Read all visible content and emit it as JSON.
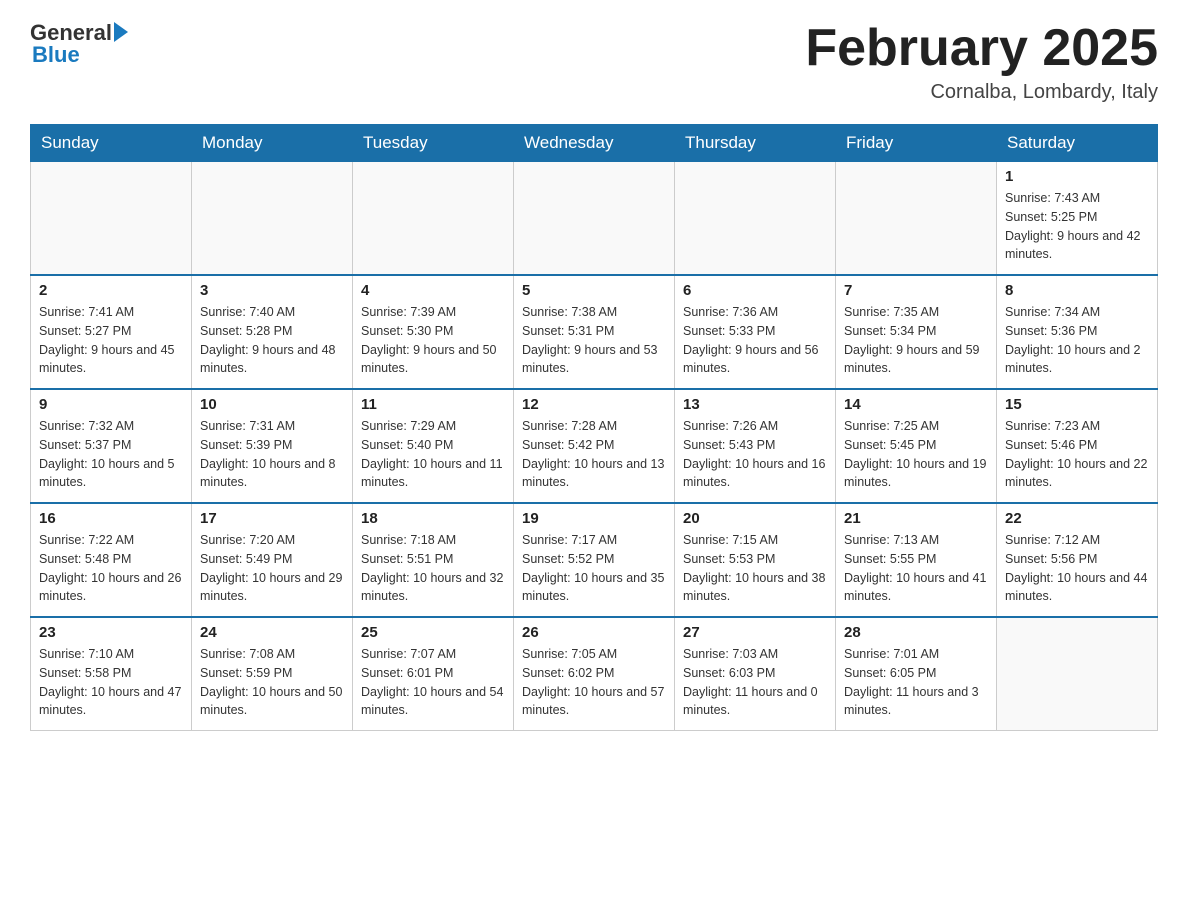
{
  "header": {
    "logo_general": "General",
    "logo_blue": "Blue",
    "title": "February 2025",
    "location": "Cornalba, Lombardy, Italy"
  },
  "days_of_week": [
    "Sunday",
    "Monday",
    "Tuesday",
    "Wednesday",
    "Thursday",
    "Friday",
    "Saturday"
  ],
  "weeks": [
    [
      {
        "day": "",
        "info": ""
      },
      {
        "day": "",
        "info": ""
      },
      {
        "day": "",
        "info": ""
      },
      {
        "day": "",
        "info": ""
      },
      {
        "day": "",
        "info": ""
      },
      {
        "day": "",
        "info": ""
      },
      {
        "day": "1",
        "info": "Sunrise: 7:43 AM\nSunset: 5:25 PM\nDaylight: 9 hours and 42 minutes."
      }
    ],
    [
      {
        "day": "2",
        "info": "Sunrise: 7:41 AM\nSunset: 5:27 PM\nDaylight: 9 hours and 45 minutes."
      },
      {
        "day": "3",
        "info": "Sunrise: 7:40 AM\nSunset: 5:28 PM\nDaylight: 9 hours and 48 minutes."
      },
      {
        "day": "4",
        "info": "Sunrise: 7:39 AM\nSunset: 5:30 PM\nDaylight: 9 hours and 50 minutes."
      },
      {
        "day": "5",
        "info": "Sunrise: 7:38 AM\nSunset: 5:31 PM\nDaylight: 9 hours and 53 minutes."
      },
      {
        "day": "6",
        "info": "Sunrise: 7:36 AM\nSunset: 5:33 PM\nDaylight: 9 hours and 56 minutes."
      },
      {
        "day": "7",
        "info": "Sunrise: 7:35 AM\nSunset: 5:34 PM\nDaylight: 9 hours and 59 minutes."
      },
      {
        "day": "8",
        "info": "Sunrise: 7:34 AM\nSunset: 5:36 PM\nDaylight: 10 hours and 2 minutes."
      }
    ],
    [
      {
        "day": "9",
        "info": "Sunrise: 7:32 AM\nSunset: 5:37 PM\nDaylight: 10 hours and 5 minutes."
      },
      {
        "day": "10",
        "info": "Sunrise: 7:31 AM\nSunset: 5:39 PM\nDaylight: 10 hours and 8 minutes."
      },
      {
        "day": "11",
        "info": "Sunrise: 7:29 AM\nSunset: 5:40 PM\nDaylight: 10 hours and 11 minutes."
      },
      {
        "day": "12",
        "info": "Sunrise: 7:28 AM\nSunset: 5:42 PM\nDaylight: 10 hours and 13 minutes."
      },
      {
        "day": "13",
        "info": "Sunrise: 7:26 AM\nSunset: 5:43 PM\nDaylight: 10 hours and 16 minutes."
      },
      {
        "day": "14",
        "info": "Sunrise: 7:25 AM\nSunset: 5:45 PM\nDaylight: 10 hours and 19 minutes."
      },
      {
        "day": "15",
        "info": "Sunrise: 7:23 AM\nSunset: 5:46 PM\nDaylight: 10 hours and 22 minutes."
      }
    ],
    [
      {
        "day": "16",
        "info": "Sunrise: 7:22 AM\nSunset: 5:48 PM\nDaylight: 10 hours and 26 minutes."
      },
      {
        "day": "17",
        "info": "Sunrise: 7:20 AM\nSunset: 5:49 PM\nDaylight: 10 hours and 29 minutes."
      },
      {
        "day": "18",
        "info": "Sunrise: 7:18 AM\nSunset: 5:51 PM\nDaylight: 10 hours and 32 minutes."
      },
      {
        "day": "19",
        "info": "Sunrise: 7:17 AM\nSunset: 5:52 PM\nDaylight: 10 hours and 35 minutes."
      },
      {
        "day": "20",
        "info": "Sunrise: 7:15 AM\nSunset: 5:53 PM\nDaylight: 10 hours and 38 minutes."
      },
      {
        "day": "21",
        "info": "Sunrise: 7:13 AM\nSunset: 5:55 PM\nDaylight: 10 hours and 41 minutes."
      },
      {
        "day": "22",
        "info": "Sunrise: 7:12 AM\nSunset: 5:56 PM\nDaylight: 10 hours and 44 minutes."
      }
    ],
    [
      {
        "day": "23",
        "info": "Sunrise: 7:10 AM\nSunset: 5:58 PM\nDaylight: 10 hours and 47 minutes."
      },
      {
        "day": "24",
        "info": "Sunrise: 7:08 AM\nSunset: 5:59 PM\nDaylight: 10 hours and 50 minutes."
      },
      {
        "day": "25",
        "info": "Sunrise: 7:07 AM\nSunset: 6:01 PM\nDaylight: 10 hours and 54 minutes."
      },
      {
        "day": "26",
        "info": "Sunrise: 7:05 AM\nSunset: 6:02 PM\nDaylight: 10 hours and 57 minutes."
      },
      {
        "day": "27",
        "info": "Sunrise: 7:03 AM\nSunset: 6:03 PM\nDaylight: 11 hours and 0 minutes."
      },
      {
        "day": "28",
        "info": "Sunrise: 7:01 AM\nSunset: 6:05 PM\nDaylight: 11 hours and 3 minutes."
      },
      {
        "day": "",
        "info": ""
      }
    ]
  ]
}
